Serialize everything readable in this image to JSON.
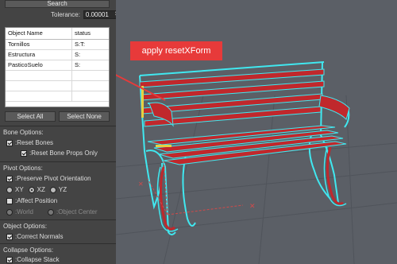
{
  "top": {
    "search_label": "Search",
    "tolerance_label": "Tolerance:",
    "tolerance_value": "0.00001"
  },
  "object_list": {
    "columns": [
      "Object Name",
      "status"
    ],
    "rows": [
      {
        "name": "Tornillos",
        "status": "S:T:"
      },
      {
        "name": "Estructura",
        "status": "S:"
      },
      {
        "name": "PasticoSuelo",
        "status": "S:"
      }
    ]
  },
  "buttons": {
    "select_all": "Select All",
    "select_none": "Select None"
  },
  "bone_options": {
    "title": "Bone Options:",
    "reset_bones": ":Reset Bones",
    "reset_bone_props": ":Reset Bone Props Only"
  },
  "pivot_options": {
    "title": "Pivot Options:",
    "preserve_orientation": ":Preserve Pivot Orientation",
    "axes": [
      "XY",
      "XZ",
      "YZ"
    ],
    "affect_position": ":Affect Position",
    "world": ":World",
    "object_center": ":Object Center"
  },
  "object_options": {
    "title": "Object Options:",
    "correct_normals": ":Correct Normals"
  },
  "collapse_options": {
    "title": "Collapse Options:",
    "collapse_stack": ":Collapse Stack"
  },
  "callout": {
    "text": "apply resetXForm"
  },
  "colors": {
    "accent_red": "#e73a3a",
    "selection_cyan": "#40e8f0",
    "bench_red": "#c0282c"
  }
}
